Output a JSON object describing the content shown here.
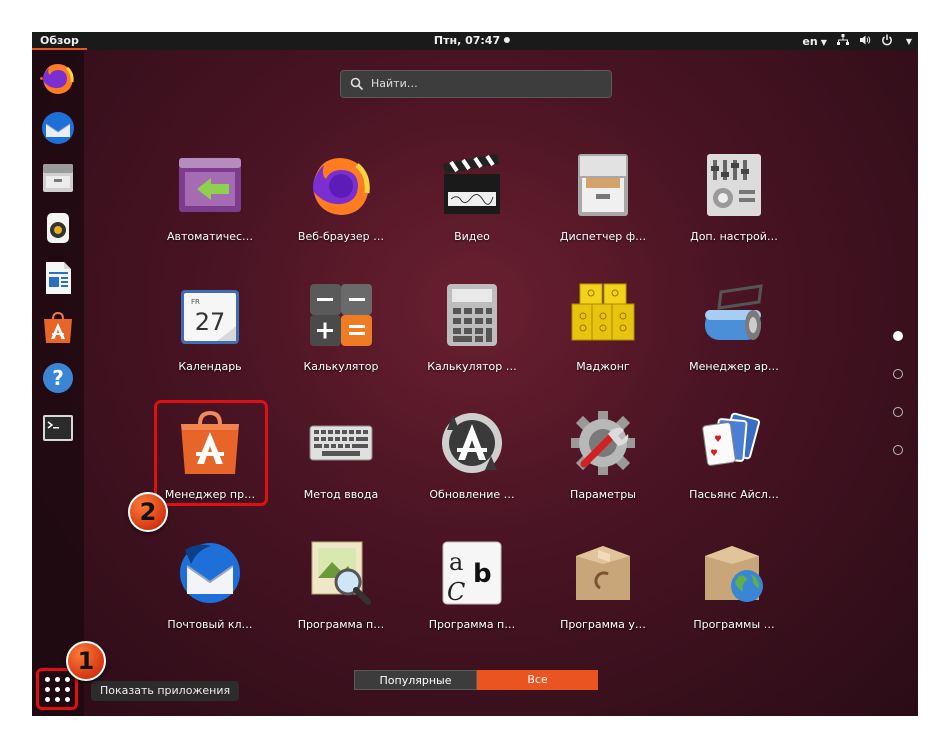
{
  "topbar": {
    "overview": "Обзор",
    "clock": "Птн, 07:47",
    "language": "en",
    "tray_icons": [
      "network-icon",
      "volume-icon",
      "power-icon"
    ]
  },
  "dock": {
    "items": [
      "firefox-icon",
      "thunderbird-icon",
      "files-icon",
      "rhythmbox-icon",
      "writer-icon",
      "software-icon",
      "help-icon",
      "terminal-icon"
    ],
    "show_apps_tooltip": "Показать приложения"
  },
  "search": {
    "placeholder": "Найти…"
  },
  "apps": [
    {
      "label": "Автоматичес…",
      "icon": "startup-apps-icon"
    },
    {
      "label": "Веб-браузер …",
      "icon": "firefox-icon"
    },
    {
      "label": "Видео",
      "icon": "video-clapper-icon"
    },
    {
      "label": "Диспетчер ф…",
      "icon": "file-cabinet-icon"
    },
    {
      "label": "Доп. настрой…",
      "icon": "tweaks-icon"
    },
    {
      "label": "Календарь",
      "icon": "calendar-icon",
      "calendar_day": "FR",
      "calendar_date": "27"
    },
    {
      "label": "Калькулятор",
      "icon": "calculator-icon"
    },
    {
      "label": "Калькулятор …",
      "icon": "calculator-grey-icon"
    },
    {
      "label": "Маджонг",
      "icon": "mahjong-icon"
    },
    {
      "label": "Менеджер ар…",
      "icon": "archive-manager-icon"
    },
    {
      "label": "Менеджер пр…",
      "icon": "software-center-icon"
    },
    {
      "label": "Метод ввода",
      "icon": "keyboard-icon"
    },
    {
      "label": "Обновление …",
      "icon": "software-updater-icon"
    },
    {
      "label": "Параметры",
      "icon": "settings-gear-icon"
    },
    {
      "label": "Пасьянс Айсл…",
      "icon": "playing-cards-icon"
    },
    {
      "label": "Почтовый кл…",
      "icon": "thunderbird-icon"
    },
    {
      "label": "Программа п…",
      "icon": "image-viewer-icon"
    },
    {
      "label": "Программа п…",
      "icon": "font-viewer-icon",
      "font_glyphs": [
        "a",
        "b",
        "C"
      ]
    },
    {
      "label": "Программа у…",
      "icon": "debian-package-icon"
    },
    {
      "label": "Программы …",
      "icon": "package-globe-icon"
    }
  ],
  "annotations": {
    "step1": "1",
    "step2": "2"
  },
  "view_toggle": {
    "popular": "Популярные",
    "all": "Все"
  },
  "pager": {
    "pages": 4,
    "active": 0
  },
  "colors": {
    "accent": "#e95420",
    "highlight": "#e01010"
  }
}
